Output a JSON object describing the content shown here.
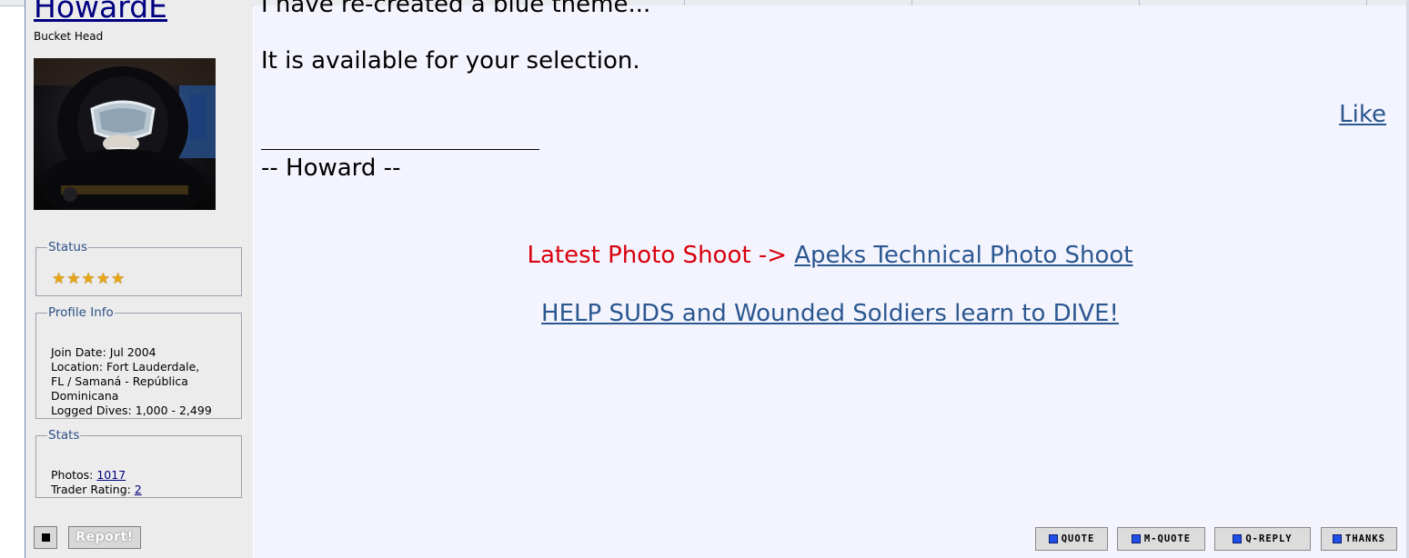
{
  "user": {
    "username": "HowardE",
    "title": "Bucket Head",
    "avatar_alt": "diver"
  },
  "status_box": {
    "legend": "Status",
    "stars": [
      "★",
      "★",
      "★",
      "★",
      "★"
    ]
  },
  "profile_box": {
    "legend": "Profile Info",
    "join_date": "Join Date: Jul 2004",
    "location_1": "Location: Fort Lauderdale,",
    "location_2": "FL / Samaná - República",
    "location_3": "Dominicana",
    "logged_dives": "Logged Dives: 1,000 - 2,499"
  },
  "stats_box": {
    "legend": "Stats",
    "photos_label": "Photos: ",
    "photos_value": "1017",
    "trader_label": "Trader Rating: ",
    "trader_value": "2"
  },
  "sidebar_buttons": {
    "report": "Report!"
  },
  "post": {
    "line1": "I have re-created a blue theme...",
    "line2": "It is available for your selection.",
    "like": "Like",
    "signature_name": "-- Howard --",
    "photo_prefix": "Latest Photo Shoot -> ",
    "photo_link": "Apeks Technical Photo Shoot",
    "help_link": "HELP SUDS and Wounded Soldiers learn to DIVE!"
  },
  "actions": {
    "quote": "QUOTE",
    "mquote": "M-QUOTE",
    "qreply": "Q-REPLY",
    "thanks": "THANKS"
  },
  "colors": {
    "post_bg": "#f3f4fd",
    "sidebar_bg": "#ececec",
    "link": "#2b5790",
    "red": "#d9000d",
    "legend": "#2c4f86"
  }
}
